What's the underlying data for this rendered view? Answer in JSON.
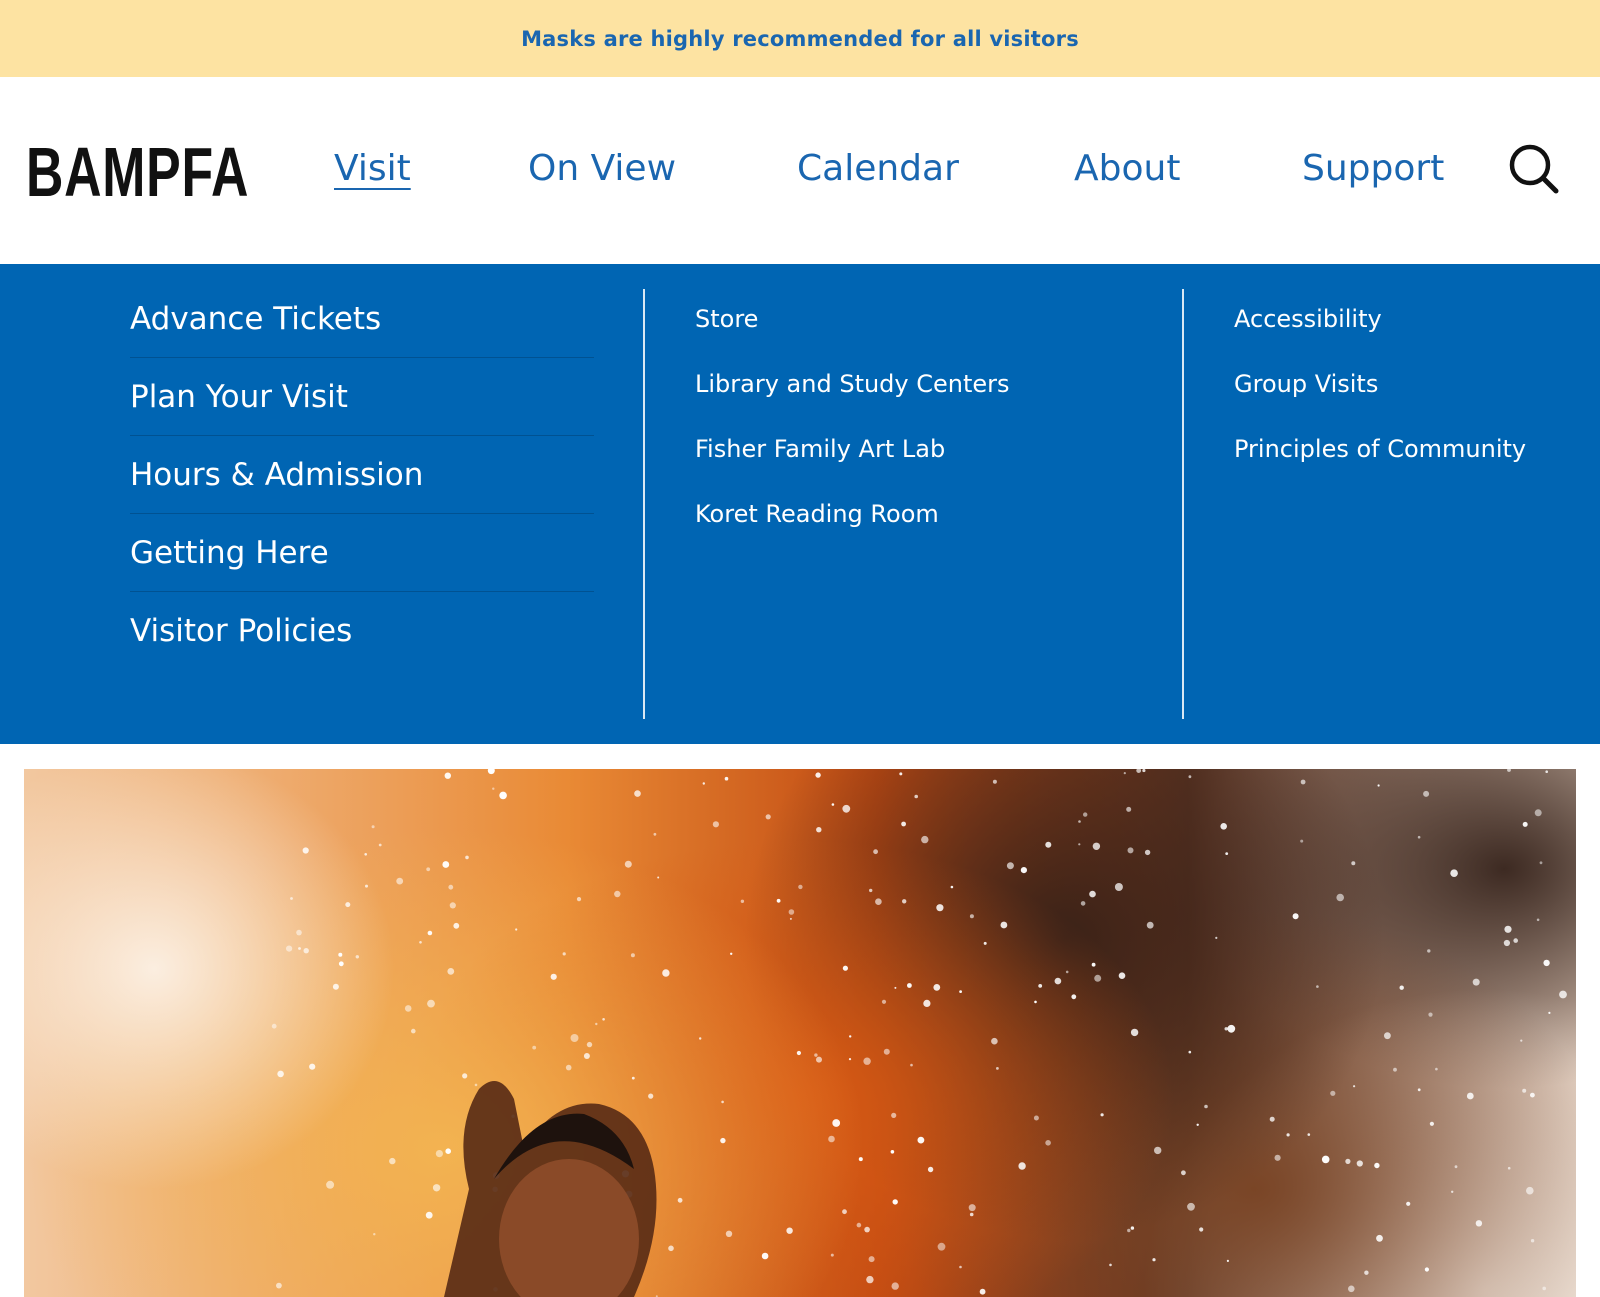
{
  "announcement": {
    "text": "Masks are highly recommended for all visitors"
  },
  "header": {
    "logo": "BAMPFA",
    "nav": [
      {
        "label": "Visit",
        "active": true
      },
      {
        "label": "On View",
        "active": false
      },
      {
        "label": "Calendar",
        "active": false
      },
      {
        "label": "About",
        "active": false
      },
      {
        "label": "Support",
        "active": false
      }
    ],
    "search_icon": "search-icon"
  },
  "mega_menu": {
    "primary": [
      "Advance Tickets",
      "Plan Your Visit",
      "Hours & Admission",
      "Getting Here",
      "Visitor Policies"
    ],
    "secondary": [
      "Store",
      "Library and Study Centers",
      "Fisher Family Art Lab",
      "Koret Reading Room"
    ],
    "tertiary": [
      "Accessibility",
      "Group Visits",
      "Principles of Community"
    ]
  },
  "colors": {
    "announcement_bg": "#fde3a2",
    "brand_blue": "#1a66b0",
    "menu_bg": "#0065b3"
  }
}
